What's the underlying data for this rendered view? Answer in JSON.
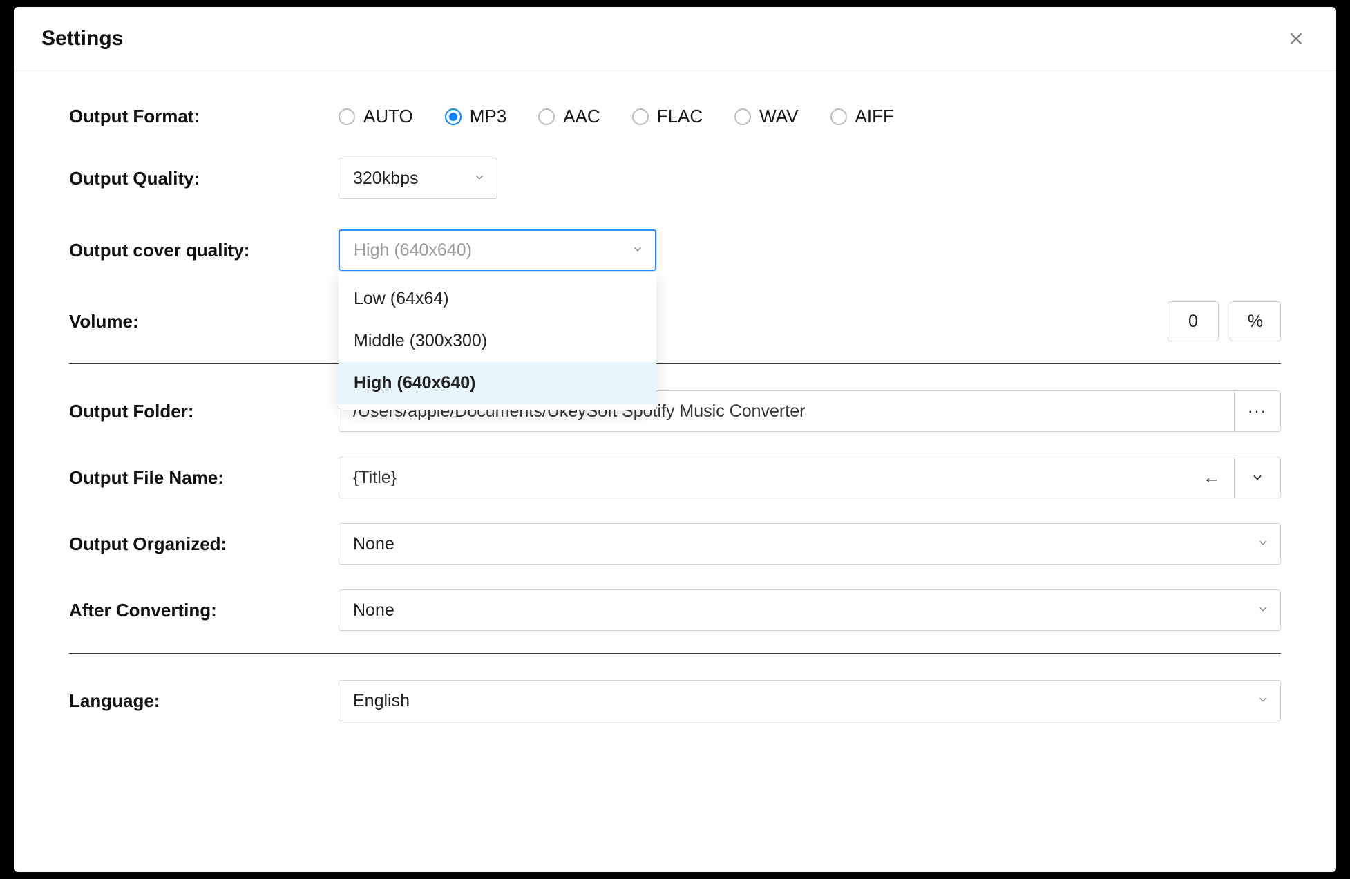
{
  "modal": {
    "title": "Settings"
  },
  "labels": {
    "output_format": "Output Format:",
    "output_quality": "Output Quality:",
    "output_cover_quality": "Output cover quality:",
    "volume": "Volume:",
    "output_folder": "Output Folder:",
    "output_file_name": "Output File Name:",
    "output_organized": "Output Organized:",
    "after_converting": "After Converting:",
    "language": "Language:"
  },
  "format": {
    "options": [
      "AUTO",
      "MP3",
      "AAC",
      "FLAC",
      "WAV",
      "AIFF"
    ],
    "selected": "MP3"
  },
  "quality": {
    "selected": "320kbps"
  },
  "cover_quality": {
    "placeholder": "High (640x640)",
    "options": [
      "Low (64x64)",
      "Middle (300x300)",
      "High (640x640)"
    ],
    "active": "High (640x640)"
  },
  "volume": {
    "value_suffix": "0",
    "unit": "%"
  },
  "output_folder": {
    "path": "/Users/apple/Documents/UkeySoft Spotify Music Converter",
    "browse": "···"
  },
  "output_file_name": {
    "value": "{Title}"
  },
  "output_organized": {
    "value": "None"
  },
  "after_converting": {
    "value": "None"
  },
  "language": {
    "value": "English"
  }
}
